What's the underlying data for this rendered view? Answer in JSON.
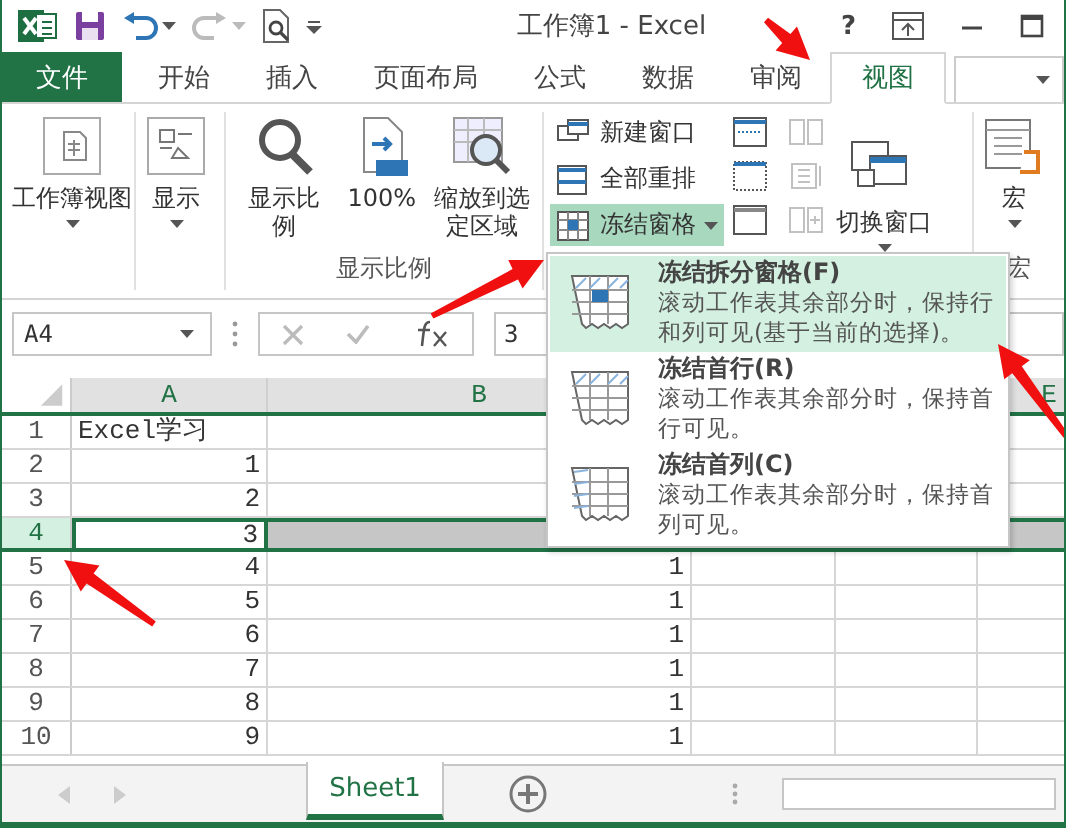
{
  "window": {
    "title": "工作簿1 - Excel",
    "help": "?"
  },
  "ribbon_tabs": [
    {
      "label": "文件",
      "kind": "file",
      "selected": false
    },
    {
      "label": "开始",
      "kind": "tab",
      "selected": false
    },
    {
      "label": "插入",
      "kind": "tab",
      "selected": false
    },
    {
      "label": "页面布局",
      "kind": "tab",
      "selected": false
    },
    {
      "label": "公式",
      "kind": "tab",
      "selected": false
    },
    {
      "label": "数据",
      "kind": "tab",
      "selected": false
    },
    {
      "label": "审阅",
      "kind": "tab",
      "selected": false
    },
    {
      "label": "视图",
      "kind": "tab",
      "selected": true
    }
  ],
  "ribbon_groups": [
    {
      "kind": "large",
      "buttons": [
        {
          "label": "工作簿视图",
          "dropdown": true
        }
      ]
    },
    {
      "kind": "large",
      "buttons": [
        {
          "label": "显示",
          "dropdown": true
        }
      ]
    },
    {
      "kind": "large",
      "label": "显示比例",
      "buttons": [
        {
          "label": "显示比例",
          "dropdown": false
        },
        {
          "label": "100%",
          "dropdown": false
        },
        {
          "label": "缩放到选定区域",
          "dropdown": false
        }
      ]
    },
    {
      "kind": "window",
      "buttons": [
        {
          "label": "新建窗口",
          "active": false,
          "dropdown": false
        },
        {
          "label": "全部重排",
          "active": false,
          "dropdown": false
        },
        {
          "label": "冻结窗格",
          "active": true,
          "dropdown": true
        }
      ],
      "icon_buttons": [
        {
          "disabled": false
        },
        {
          "disabled": false
        },
        {
          "disabled": false
        },
        {
          "disabled": true
        },
        {
          "disabled": true
        },
        {
          "disabled": true
        }
      ],
      "switch": {
        "label": "切换窗口",
        "dropdown": true
      }
    },
    {
      "kind": "large",
      "label": "宏",
      "buttons": [
        {
          "label": "宏",
          "dropdown": true
        }
      ]
    }
  ],
  "formula_bar": {
    "name_box": "A4",
    "value": "3"
  },
  "grid": {
    "columns": [
      {
        "label": "A"
      },
      {
        "label": "B"
      },
      {},
      {},
      {
        "label": "E"
      }
    ],
    "rows": [
      {
        "header": "1",
        "selected": false,
        "cells": [
          {
            "text": "Excel学习",
            "kind": "text"
          }
        ]
      },
      {
        "header": "2",
        "selected": false,
        "cells": [
          {
            "text": "1",
            "kind": "number"
          }
        ]
      },
      {
        "header": "3",
        "selected": false,
        "cells": [
          {
            "text": "2",
            "kind": "number"
          }
        ]
      },
      {
        "header": "4",
        "selected": true,
        "cells": [
          {
            "text": "3",
            "kind": "number"
          }
        ]
      },
      {
        "header": "5",
        "selected": false,
        "cells": [
          {
            "text": "4",
            "kind": "number"
          },
          {
            "text": "1",
            "kind": "number"
          }
        ]
      },
      {
        "header": "6",
        "selected": false,
        "cells": [
          {
            "text": "5",
            "kind": "number"
          },
          {
            "text": "1",
            "kind": "number"
          }
        ]
      },
      {
        "header": "7",
        "selected": false,
        "cells": [
          {
            "text": "6",
            "kind": "number"
          },
          {
            "text": "1",
            "kind": "number"
          }
        ]
      },
      {
        "header": "8",
        "selected": false,
        "cells": [
          {
            "text": "7",
            "kind": "number"
          },
          {
            "text": "1",
            "kind": "number"
          }
        ]
      },
      {
        "header": "9",
        "selected": false,
        "cells": [
          {
            "text": "8",
            "kind": "number"
          },
          {
            "text": "1",
            "kind": "number"
          }
        ]
      },
      {
        "header": "10",
        "selected": false,
        "cells": [
          {
            "text": "9",
            "kind": "number"
          },
          {
            "text": "1",
            "kind": "number"
          }
        ]
      }
    ]
  },
  "sheet_tabs": [
    {
      "label": "Sheet1",
      "selected": true
    }
  ],
  "dropdown_menu": {
    "items": [
      {
        "title": "冻结拆分窗格(F)",
        "description": "滚动工作表其余部分时，保持行和列可见(基于当前的选择)。",
        "selected": true
      },
      {
        "title": "冻结首行(R)",
        "description": "滚动工作表其余部分时，保持首行可见。",
        "selected": false
      },
      {
        "title": "冻结首列(C)",
        "description": "滚动工作表其余部分时，保持首列可见。",
        "selected": false
      }
    ]
  }
}
